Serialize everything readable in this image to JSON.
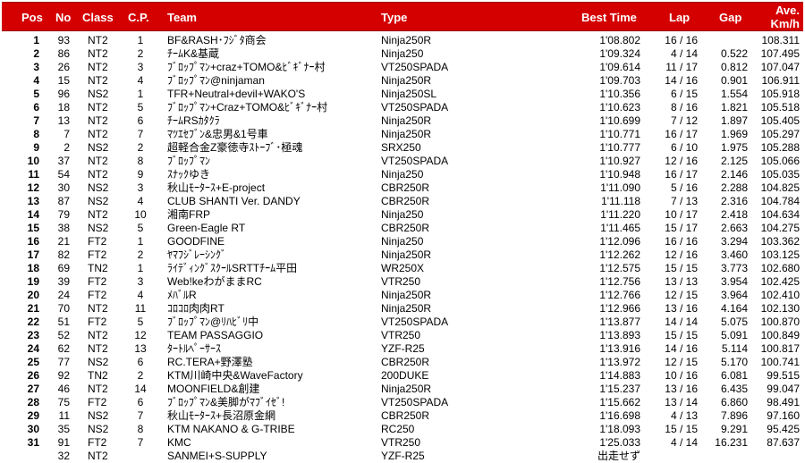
{
  "headers": {
    "pos": "Pos",
    "no": "No",
    "class": "Class",
    "cp": "C.P.",
    "team": "Team",
    "type": "Type",
    "best_time": "Best Time",
    "lap": "Lap",
    "gap": "Gap",
    "ave_line1": "Ave.",
    "ave_line2": "Km/h"
  },
  "rows": [
    {
      "pos": "1",
      "no": "93",
      "class": "NT2",
      "cp": "1",
      "team": "BF&RASH･ﾌｼﾞﾀ商会",
      "type": "Ninja250R",
      "best": "1'08.802",
      "lap": "16 / 16",
      "gap": "",
      "ave": "108.311"
    },
    {
      "pos": "2",
      "no": "86",
      "class": "NT2",
      "cp": "2",
      "team": "ﾁｰﾑK&基蔵",
      "type": "Ninja250",
      "best": "1'09.324",
      "lap": "4 / 14",
      "gap": "0.522",
      "ave": "107.495"
    },
    {
      "pos": "3",
      "no": "26",
      "class": "NT2",
      "cp": "3",
      "team": "ﾌﾞﾛｯﾌﾟﾏﾝ+craz+TOMO&ﾋﾞｷﾞﾅｰ村",
      "type": "VT250SPADA",
      "best": "1'09.614",
      "lap": "11 / 17",
      "gap": "0.812",
      "ave": "107.047"
    },
    {
      "pos": "4",
      "no": "15",
      "class": "NT2",
      "cp": "4",
      "team": "ﾌﾞﾛｯﾌﾟﾏﾝ@ninjaman",
      "type": "Ninja250R",
      "best": "1'09.703",
      "lap": "14 / 16",
      "gap": "0.901",
      "ave": "106.911"
    },
    {
      "pos": "5",
      "no": "96",
      "class": "NS2",
      "cp": "1",
      "team": "TFR+Neutral+devil+WAKO'S",
      "type": "Ninja250SL",
      "best": "1'10.356",
      "lap": "6 / 15",
      "gap": "1.554",
      "ave": "105.918"
    },
    {
      "pos": "6",
      "no": "18",
      "class": "NT2",
      "cp": "5",
      "team": "ﾌﾞﾛｯﾌﾟﾏﾝ+Craz+TOMO&ﾋﾞｷﾞﾅｰ村",
      "type": "VT250SPADA",
      "best": "1'10.623",
      "lap": "8 / 16",
      "gap": "1.821",
      "ave": "105.518"
    },
    {
      "pos": "7",
      "no": "13",
      "class": "NT2",
      "cp": "6",
      "team": "ﾁｰﾑRSｶﾀｸﾗ",
      "type": "Ninja250R",
      "best": "1'10.699",
      "lap": "7 / 12",
      "gap": "1.897",
      "ave": "105.405"
    },
    {
      "pos": "8",
      "no": "7",
      "class": "NT2",
      "cp": "7",
      "team": "ﾏﾂｴｾﾌﾞﾝ&忠男&1号車",
      "type": "Ninja250R",
      "best": "1'10.771",
      "lap": "16 / 17",
      "gap": "1.969",
      "ave": "105.297"
    },
    {
      "pos": "9",
      "no": "2",
      "class": "NS2",
      "cp": "2",
      "team": "超軽合金Z豪徳寺ｽﾄｰﾌﾞ･極魂",
      "type": "SRX250",
      "best": "1'10.777",
      "lap": "6 / 10",
      "gap": "1.975",
      "ave": "105.288"
    },
    {
      "pos": "10",
      "no": "37",
      "class": "NT2",
      "cp": "8",
      "team": "ﾌﾞﾛｯﾌﾟﾏﾝ",
      "type": "VT250SPADA",
      "best": "1'10.927",
      "lap": "12 / 16",
      "gap": "2.125",
      "ave": "105.066"
    },
    {
      "pos": "11",
      "no": "54",
      "class": "NT2",
      "cp": "9",
      "team": "ｽﾅｯｸゆき",
      "type": "Ninja250",
      "best": "1'10.948",
      "lap": "16 / 17",
      "gap": "2.146",
      "ave": "105.035"
    },
    {
      "pos": "12",
      "no": "30",
      "class": "NS2",
      "cp": "3",
      "team": "秋山ﾓｰﾀｰｽ+E-project",
      "type": "CBR250R",
      "best": "1'11.090",
      "lap": "5 / 16",
      "gap": "2.288",
      "ave": "104.825"
    },
    {
      "pos": "13",
      "no": "87",
      "class": "NS2",
      "cp": "4",
      "team": "CLUB SHANTI Ver. DANDY",
      "type": "CBR250R",
      "best": "1'11.118",
      "lap": "7 / 13",
      "gap": "2.316",
      "ave": "104.784"
    },
    {
      "pos": "14",
      "no": "79",
      "class": "NT2",
      "cp": "10",
      "team": "湘南FRP",
      "type": "Ninja250",
      "best": "1'11.220",
      "lap": "10 / 17",
      "gap": "2.418",
      "ave": "104.634"
    },
    {
      "pos": "15",
      "no": "38",
      "class": "NS2",
      "cp": "5",
      "team": "Green-Eagle RT",
      "type": "CBR250R",
      "best": "1'11.465",
      "lap": "15 / 17",
      "gap": "2.663",
      "ave": "104.275"
    },
    {
      "pos": "16",
      "no": "21",
      "class": "FT2",
      "cp": "1",
      "team": "GOODFINE",
      "type": "Ninja250",
      "best": "1'12.096",
      "lap": "16 / 16",
      "gap": "3.294",
      "ave": "103.362"
    },
    {
      "pos": "17",
      "no": "82",
      "class": "FT2",
      "cp": "2",
      "team": "ﾔﾏﾌｼﾞﾚｰｼﾝｸﾞ",
      "type": "Ninja250R",
      "best": "1'12.262",
      "lap": "12 / 16",
      "gap": "3.460",
      "ave": "103.125"
    },
    {
      "pos": "18",
      "no": "69",
      "class": "TN2",
      "cp": "1",
      "team": "ﾗｲﾃﾞｨﾝｸﾞｽｸｰﾙSRTTﾁｰﾑ平田",
      "type": "WR250X",
      "best": "1'12.575",
      "lap": "15 / 15",
      "gap": "3.773",
      "ave": "102.680"
    },
    {
      "pos": "19",
      "no": "39",
      "class": "FT2",
      "cp": "3",
      "team": "Web!keわがままRC",
      "type": "VTR250",
      "best": "1'12.756",
      "lap": "13 / 13",
      "gap": "3.954",
      "ave": "102.425"
    },
    {
      "pos": "20",
      "no": "24",
      "class": "FT2",
      "cp": "4",
      "team": "ﾒﾊﾞﾙR",
      "type": "Ninja250R",
      "best": "1'12.766",
      "lap": "12 / 15",
      "gap": "3.964",
      "ave": "102.410"
    },
    {
      "pos": "21",
      "no": "70",
      "class": "NT2",
      "cp": "11",
      "team": "ｺﾛｺﾛ肉肉RT",
      "type": "Ninja250R",
      "best": "1'12.966",
      "lap": "13 / 16",
      "gap": "4.164",
      "ave": "102.130"
    },
    {
      "pos": "22",
      "no": "51",
      "class": "FT2",
      "cp": "5",
      "team": "ﾌﾞﾛｯﾌﾟﾏﾝ@ﾘﾊﾋﾞﾘ中",
      "type": "VT250SPADA",
      "best": "1'13.877",
      "lap": "14 / 14",
      "gap": "5.075",
      "ave": "100.870"
    },
    {
      "pos": "23",
      "no": "52",
      "class": "NT2",
      "cp": "12",
      "team": "TEAM PASSAGGIO",
      "type": "VTR250",
      "best": "1'13.893",
      "lap": "15 / 15",
      "gap": "5.091",
      "ave": "100.849"
    },
    {
      "pos": "24",
      "no": "62",
      "class": "NT2",
      "cp": "13",
      "team": "ﾀｰﾄﾙﾍﾟｰｻｰｽ",
      "type": "YZF-R25",
      "best": "1'13.916",
      "lap": "14 / 16",
      "gap": "5.114",
      "ave": "100.817"
    },
    {
      "pos": "25",
      "no": "77",
      "class": "NS2",
      "cp": "6",
      "team": "RC.TERA+野澤塾",
      "type": "CBR250R",
      "best": "1'13.972",
      "lap": "12 / 15",
      "gap": "5.170",
      "ave": "100.741"
    },
    {
      "pos": "26",
      "no": "92",
      "class": "TN2",
      "cp": "2",
      "team": "KTM川崎中央&WaveFactory",
      "type": "200DUKE",
      "best": "1'14.883",
      "lap": "10 / 16",
      "gap": "6.081",
      "ave": "99.515"
    },
    {
      "pos": "27",
      "no": "46",
      "class": "NT2",
      "cp": "14",
      "team": "MOONFIELD&創建",
      "type": "Ninja250R",
      "best": "1'15.237",
      "lap": "13 / 16",
      "gap": "6.435",
      "ave": "99.047"
    },
    {
      "pos": "28",
      "no": "75",
      "class": "FT2",
      "cp": "6",
      "team": "ﾌﾞﾛｯﾌﾟﾏﾝ&美脚がﾏﾌﾞｲｾﾞ!",
      "type": "VT250SPADA",
      "best": "1'15.662",
      "lap": "13 / 14",
      "gap": "6.860",
      "ave": "98.491"
    },
    {
      "pos": "29",
      "no": "11",
      "class": "NS2",
      "cp": "7",
      "team": "秋山ﾓｰﾀｰｽ+長沼原金網",
      "type": "CBR250R",
      "best": "1'16.698",
      "lap": "4 / 13",
      "gap": "7.896",
      "ave": "97.160"
    },
    {
      "pos": "30",
      "no": "35",
      "class": "NS2",
      "cp": "8",
      "team": "KTM NAKANO & G-TRIBE",
      "type": "RC250",
      "best": "1'18.093",
      "lap": "15 / 15",
      "gap": "9.291",
      "ave": "95.425"
    },
    {
      "pos": "31",
      "no": "91",
      "class": "FT2",
      "cp": "7",
      "team": "KMC",
      "type": "VTR250",
      "best": "1'25.033",
      "lap": "4 / 14",
      "gap": "16.231",
      "ave": "87.637"
    },
    {
      "pos": "",
      "no": "32",
      "class": "NT2",
      "cp": "",
      "team": "SANMEI+S-SUPPLY",
      "type": "YZF-R25",
      "best": "出走せず",
      "lap": "",
      "gap": "",
      "ave": ""
    }
  ]
}
